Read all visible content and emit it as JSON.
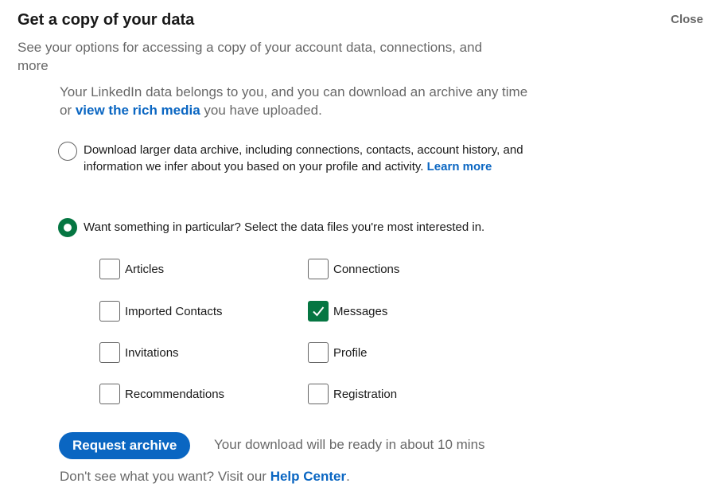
{
  "header": {
    "title": "Get a copy of your data",
    "close_label": "Close",
    "subtitle": "See your options for accessing a copy of your account data, connections, and more"
  },
  "intro": {
    "text_before": "Your LinkedIn data belongs to you, and you can download an archive any time or ",
    "link_text": "view the rich media",
    "text_after": " you have uploaded."
  },
  "options": {
    "larger_archive": {
      "label": "Download larger data archive, including connections, contacts, account history, and information we infer about you based on your profile and activity. ",
      "learn_more": "Learn more",
      "checked": false
    },
    "particular": {
      "label": "Want something in particular? Select the data files you're most interested in.",
      "checked": true
    }
  },
  "files": [
    {
      "label": "Articles",
      "checked": false
    },
    {
      "label": "Connections",
      "checked": false
    },
    {
      "label": "Imported Contacts",
      "checked": false
    },
    {
      "label": "Messages",
      "checked": true
    },
    {
      "label": "Invitations",
      "checked": false
    },
    {
      "label": "Profile",
      "checked": false
    },
    {
      "label": "Recommendations",
      "checked": false
    },
    {
      "label": "Registration",
      "checked": false
    }
  ],
  "actions": {
    "request_label": "Request archive",
    "ready_text": "Your download will be ready in about 10 mins"
  },
  "footer": {
    "text_before": "Don't see what you want? Visit our ",
    "link_text": "Help Center",
    "text_after": "."
  },
  "colors": {
    "accent_blue": "#0a66c2",
    "check_green": "#057642"
  }
}
